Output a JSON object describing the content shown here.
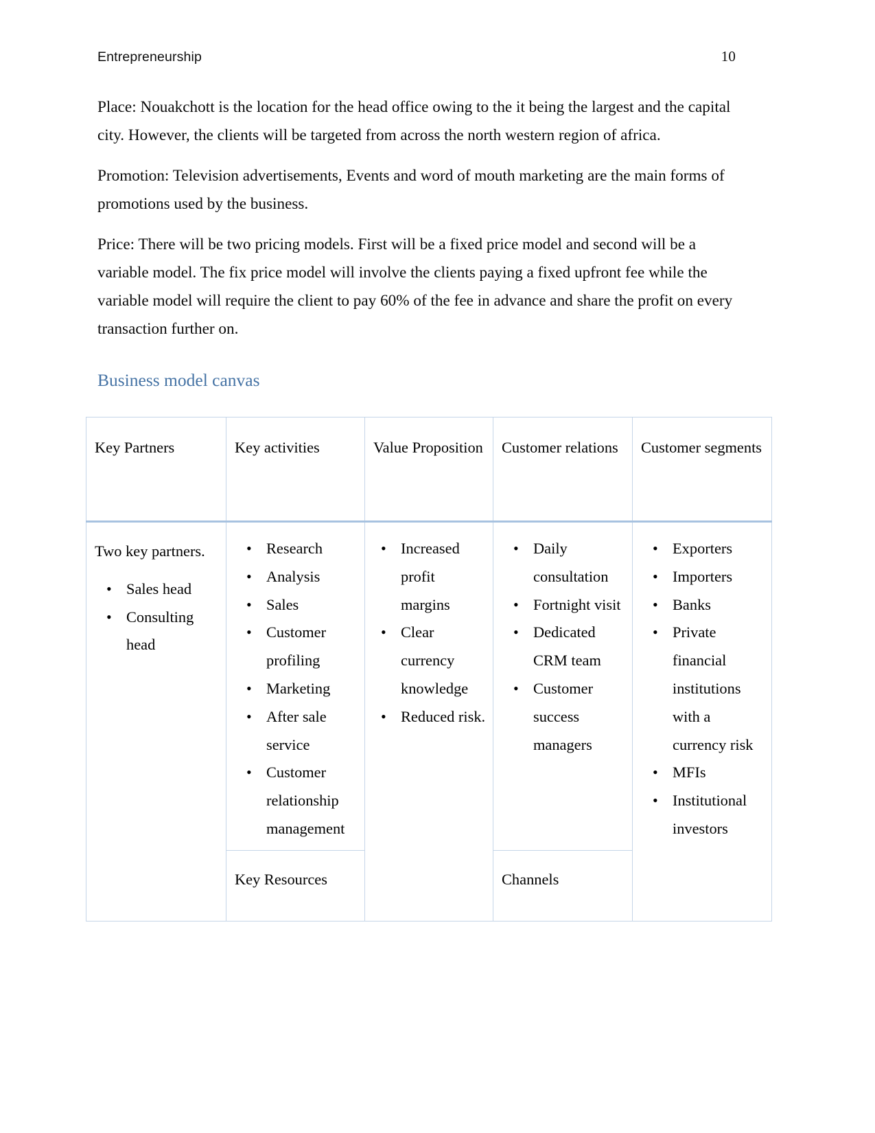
{
  "header": {
    "title": "Entrepreneurship",
    "page_number": "10"
  },
  "body": {
    "paragraphs": [
      "Place: Nouakchott is the location for the head office owing to the it being the largest and the capital city. However, the clients will be targeted from across the north western region of africa.",
      "Promotion: Television advertisements, Events and word of mouth marketing are the main forms of promotions used by the business.",
      "Price: There will be two pricing models. First will be a fixed price model and second will be a variable model. The fix price model will involve the clients paying a fixed upfront fee while the variable model will require the client to pay 60% of the fee in advance and share the profit on every transaction further on."
    ]
  },
  "section": {
    "heading": "Business model canvas",
    "heading_color": "#4472a4"
  },
  "canvas": {
    "border_color": "#c5d5e8",
    "header_rule_color": "#a7c2e0",
    "headers": [
      "Key Partners",
      "Key activities",
      "Value Proposition",
      "Customer relations",
      "Customer segments"
    ],
    "columns": {
      "key_partners": {
        "lead": "Two key partners.",
        "items": [
          "Sales head",
          "Consulting head"
        ]
      },
      "key_activities": {
        "items": [
          "Research",
          "Analysis",
          "Sales",
          "Customer profiling",
          "Marketing",
          "After sale service",
          "Customer relationship management"
        ]
      },
      "value_proposition": {
        "items": [
          "Increased profit margins",
          "Clear currency knowledge",
          "Reduced risk."
        ]
      },
      "customer_relations": {
        "items": [
          "Daily consultation",
          "Fortnight visit",
          "Dedicated CRM team",
          "Customer success managers"
        ]
      },
      "customer_segments": {
        "items": [
          "Exporters",
          "Importers",
          "Banks",
          "Private financial institutions with a currency risk",
          "MFIs",
          "Institutional investors"
        ]
      }
    },
    "sub_headers": {
      "key_resources": "Key Resources",
      "channels": "Channels"
    }
  }
}
